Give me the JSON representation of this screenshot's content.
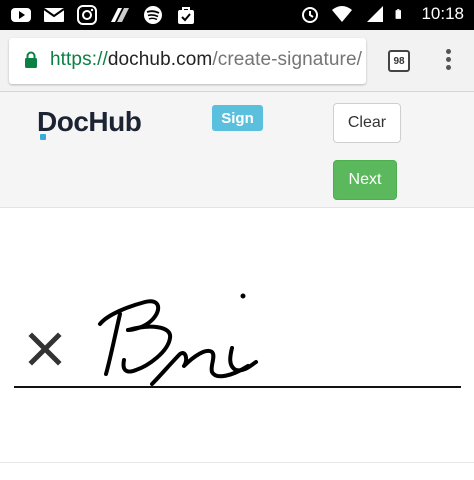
{
  "status_bar": {
    "time": "10:18",
    "left_icons": [
      "youtube-icon",
      "mail-icon",
      "instagram-icon",
      "drive-app-icon",
      "spotify-icon",
      "shopping-bag-icon"
    ],
    "right_icons": [
      "alarm-icon",
      "wifi-icon",
      "signal-icon",
      "battery-icon"
    ]
  },
  "browser": {
    "url_scheme": "https://",
    "url_host": "dochub.com",
    "url_path": "/create-signature/",
    "tab_count": "98"
  },
  "app": {
    "logo_text": "DocHub",
    "sign_badge": "Sign",
    "clear_label": "Clear",
    "next_label": "Next",
    "colors": {
      "sign_badge": "#5bc0de",
      "next_button": "#5cb85c",
      "logo_accent": "#3ba9d9"
    }
  },
  "signature": {
    "clear_mark_icon": "close-icon",
    "drawn_text": "Bri"
  }
}
